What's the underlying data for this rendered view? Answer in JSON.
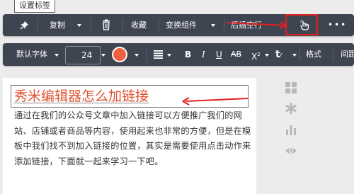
{
  "top_tag": "设置标签",
  "toolbar1": {
    "copy": "复制",
    "favorite": "收藏",
    "switch_component": "变换组件",
    "insert_after": "后插空行",
    "more": "•••"
  },
  "toolbar2": {
    "font": "默认字体",
    "font_size": "24",
    "color_swatch": "#f06040",
    "format": "格式",
    "spacing_partial": "间距"
  },
  "editor": {
    "heading": "秀米编辑器怎么加链接",
    "body": "通过在我们的公众号文章中加入链接可以方便推广我们的网站、店铺或者商品等内容，使用起来也非常的方便，但是在模板中我们找不到加入链接的位置，其实是需要使用点击动作来添加链接，下面就一起来学习一下吧。"
  },
  "colors": {
    "toolbar_bg": "#3f4451",
    "highlight": "#e02020",
    "heading": "#e0512e"
  },
  "icons": [
    "pin-icon",
    "copy-caret-icon",
    "trash-icon",
    "link-action-icon",
    "align-icon",
    "bold-icon",
    "italic-icon",
    "underline-icon",
    "strikethrough-icon",
    "superscript-icon",
    "text-color-icon",
    "grid-icon",
    "asterisk-icon",
    "bar-chart-icon",
    "eye-icon"
  ]
}
